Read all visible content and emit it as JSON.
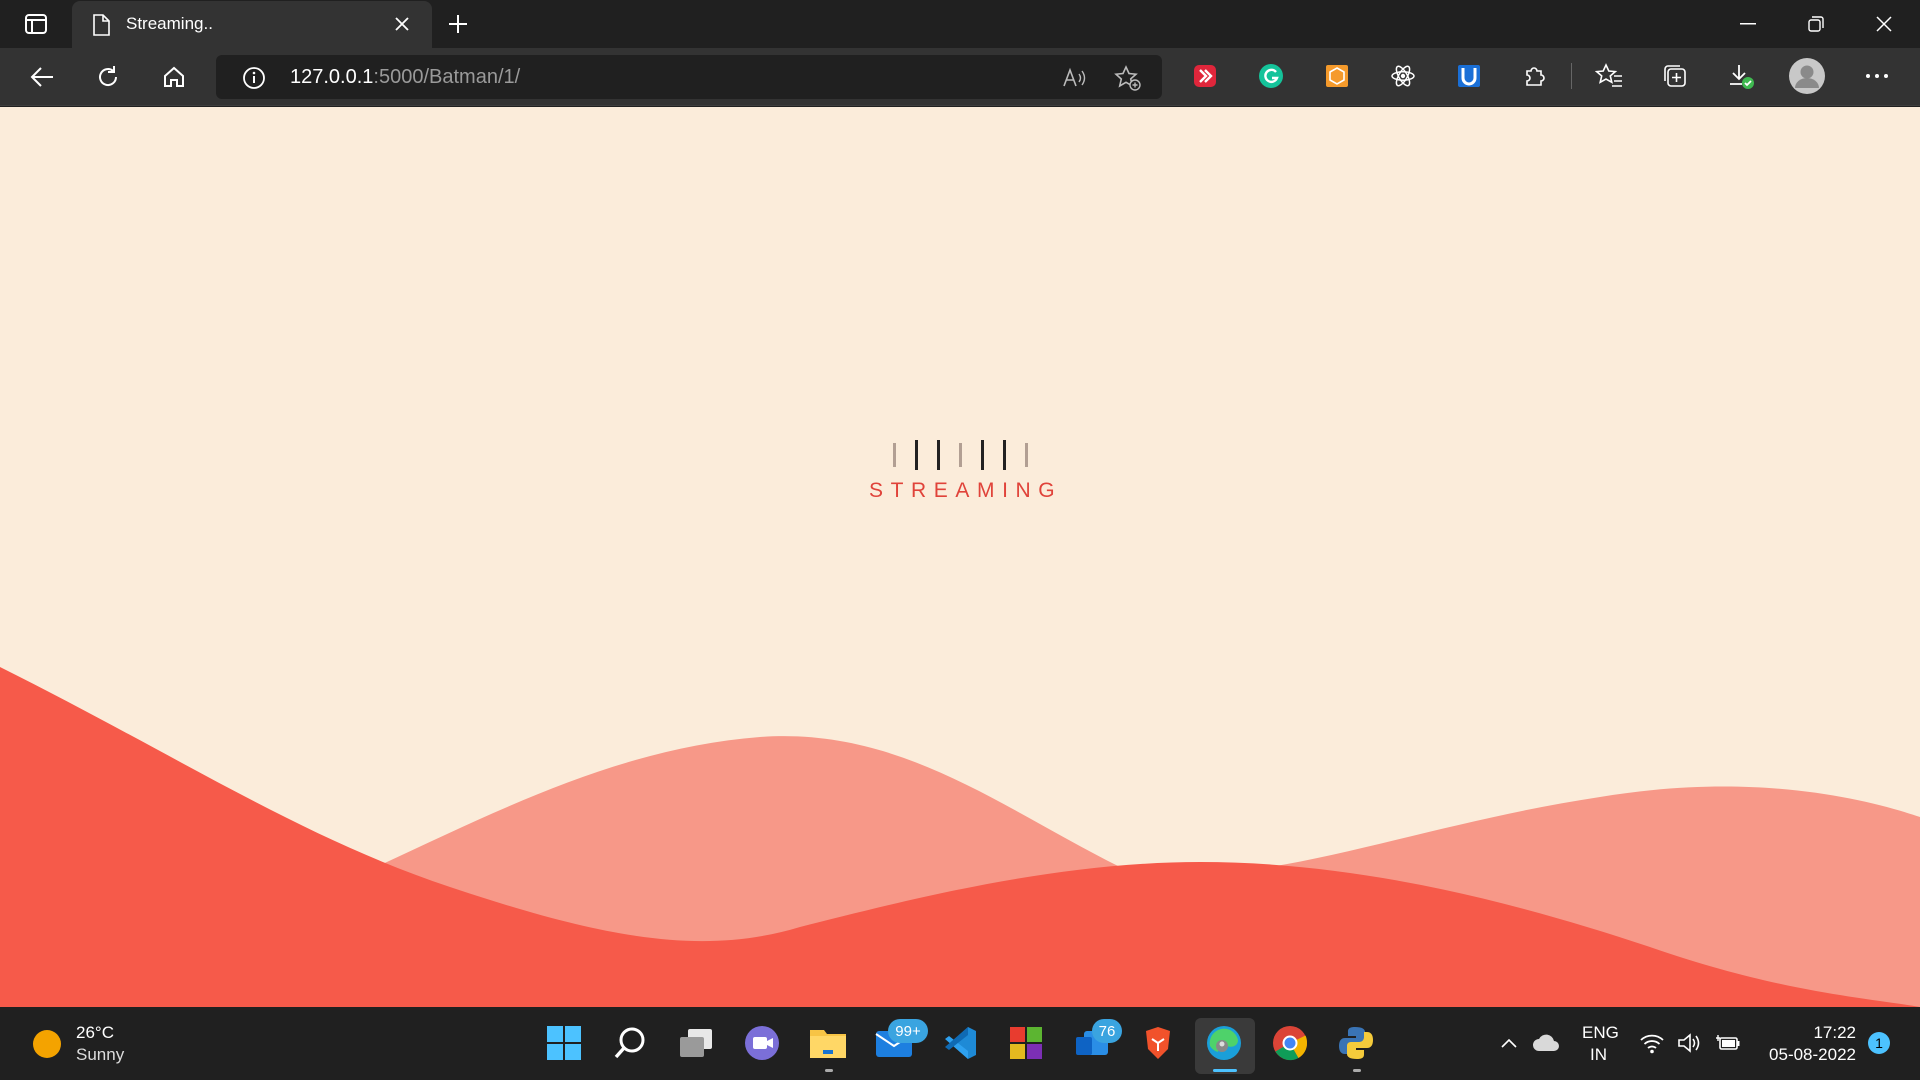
{
  "browser": {
    "tab": {
      "title": "Streaming.."
    },
    "address": {
      "host": "127.0.0.1",
      "path": ":5000/Batman/1/"
    },
    "extensions": [
      "red-arrow-extension-icon",
      "grammarly-icon",
      "orange-box-extension-icon",
      "react-devtools-icon",
      "blue-u-extension-icon"
    ]
  },
  "page": {
    "loader_label": "STREAMING",
    "colors": {
      "background": "#fbecda",
      "accent": "#e0433a",
      "wave_dark": "#f65a4a",
      "wave_light": "#f79888"
    }
  },
  "taskbar": {
    "weather": {
      "temp": "26°C",
      "condition": "Sunny"
    },
    "badges": {
      "mail": "99+",
      "teams": "76"
    },
    "language": {
      "line1": "ENG",
      "line2": "IN"
    },
    "clock": {
      "time": "17:22",
      "date": "05-08-2022"
    },
    "notifications": "1"
  }
}
